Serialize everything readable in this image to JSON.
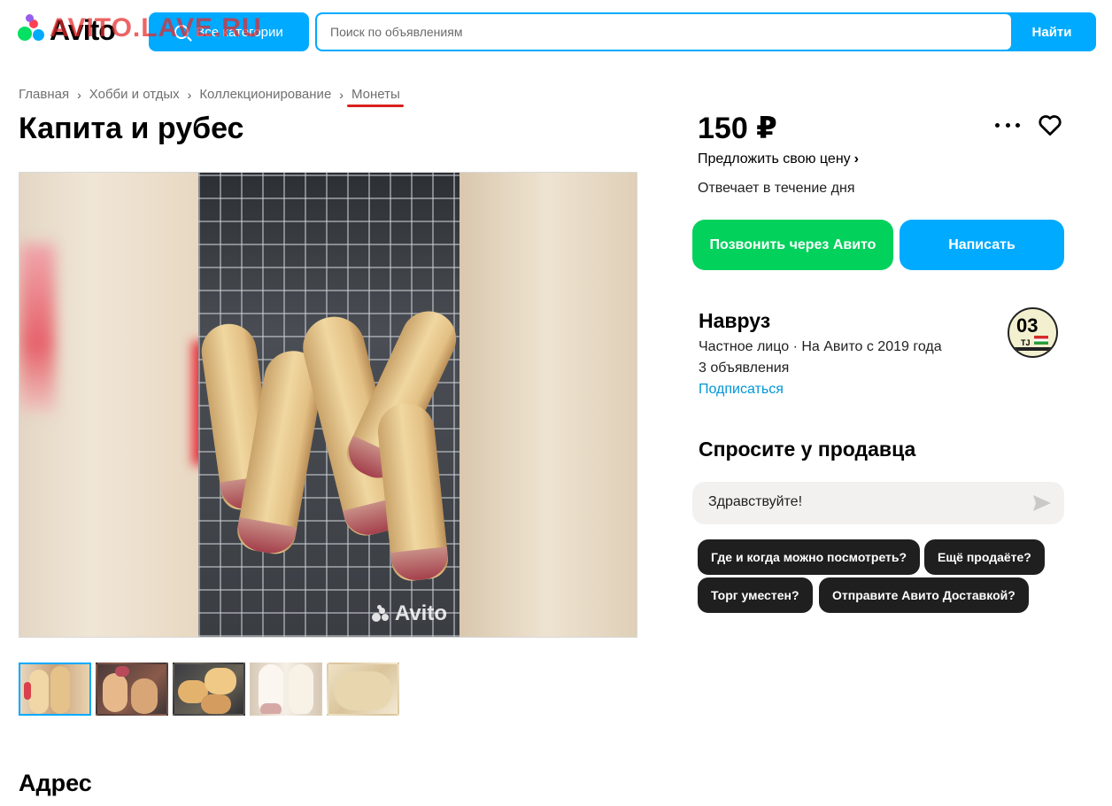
{
  "header": {
    "logo_text": "Avito",
    "watermark": "AVITO.LAVE.RU",
    "categories_button": "Все категории",
    "search_placeholder": "Поиск по объявлениям",
    "search_button": "Найти",
    "accent_color": "#00aaff"
  },
  "breadcrumb": [
    "Главная",
    "Хобби и отдых",
    "Коллекционирование",
    "Монеты"
  ],
  "listing": {
    "title": "Капита и рубес",
    "photo_watermark": "Avito",
    "thumbnail_count": 5,
    "active_thumbnail_index": 0,
    "address_heading": "Адрес"
  },
  "sidebar": {
    "price": "150 ₽",
    "offer_price": "Предложить свою цену",
    "response_time": "Отвечает в течение дня",
    "call_button": "Позвонить через Авито",
    "write_button": "Написать",
    "call_color": "#02d15c",
    "seller": {
      "name": "Навруз",
      "meta": "Частное лицо · На Авито с 2019 года",
      "listings": "3 объявления",
      "subscribe": "Подписаться",
      "avatar_number": "03",
      "avatar_code": "TJ"
    },
    "ask": {
      "title": "Спросите у продавца",
      "message": "Здравствуйте!",
      "chips": [
        "Где и когда можно посмотреть?",
        "Ещё продаёте?",
        "Торг уместен?",
        "Отправите Авито Доставкой?"
      ]
    }
  }
}
